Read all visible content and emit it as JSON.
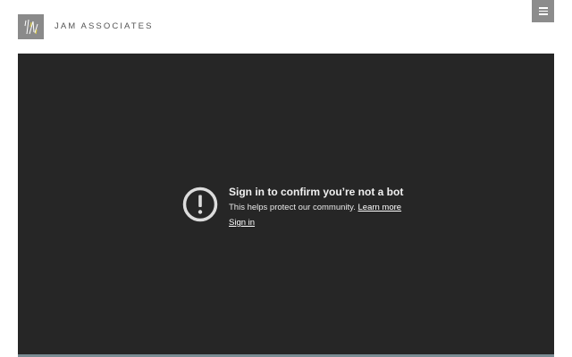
{
  "header": {
    "brand": "JAM ASSOCIATES",
    "logo_icon": "jam-logo-icon",
    "menu_icon": "hamburger-menu-icon"
  },
  "video": {
    "icon": "exclamation-circle-icon",
    "title": "Sign in to confirm you’re not a bot",
    "body_text": "This helps protect our community.",
    "learn_more_label": "Learn more",
    "sign_in_label": "Sign in"
  },
  "colors": {
    "menu_button_bg": "#8c8c8c",
    "logo_bg": "#8a8a8a",
    "logo_accent": "#d9c84a",
    "video_bg": "#262626",
    "icon_color": "#dcdcdc"
  }
}
